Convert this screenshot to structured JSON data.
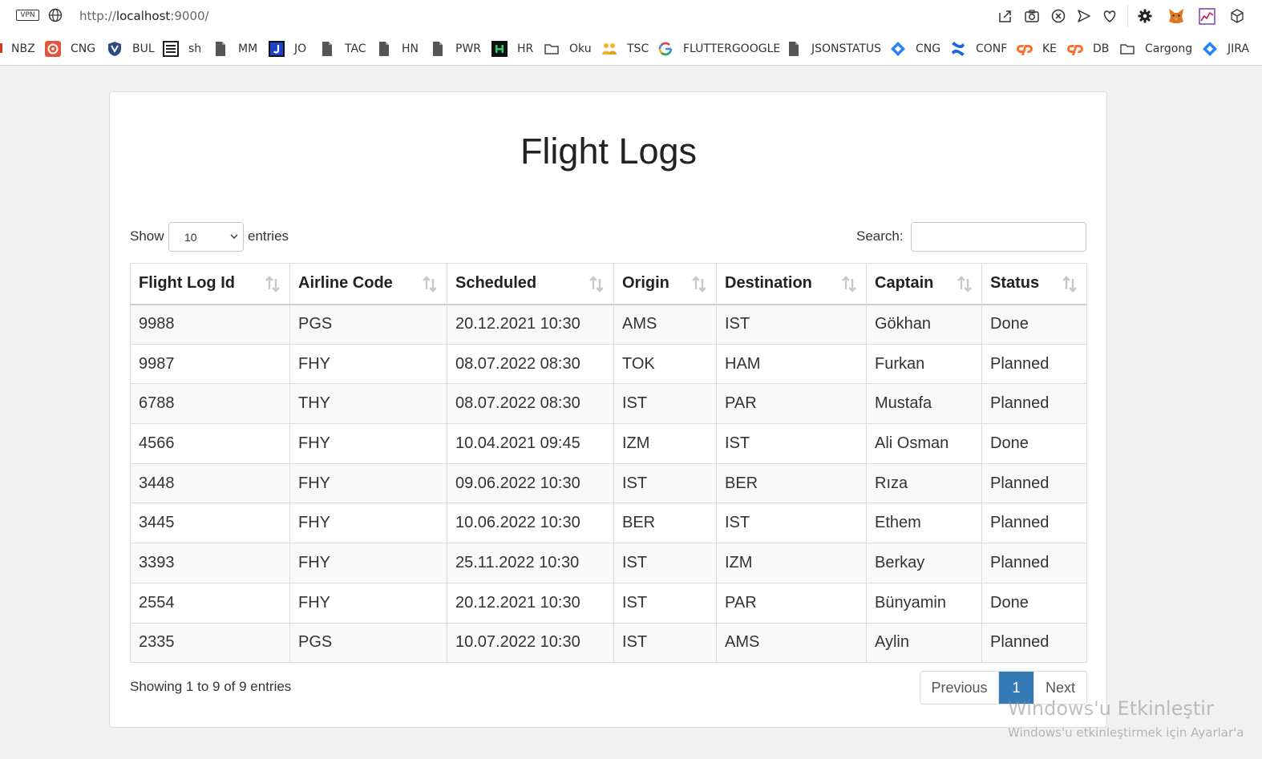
{
  "browser": {
    "vpn_label": "VPN",
    "url_scheme": "http://",
    "url_host": "localhost",
    "url_port": ":9000/",
    "toolbar_icons": [
      "share-icon",
      "camera-icon",
      "block-icon",
      "send-icon",
      "heart-icon",
      "settings-icon",
      "metamask-icon",
      "chart-icon",
      "cube-icon"
    ]
  },
  "bookmarks": [
    {
      "label": "NBZ",
      "icon": "none"
    },
    {
      "label": "CNG",
      "icon": "red-circle-icon",
      "color": "#e2543c"
    },
    {
      "label": "BUL",
      "icon": "shield-icon",
      "color": "#2b4c80"
    },
    {
      "label": "sh",
      "icon": "list-icon",
      "color": "#222222"
    },
    {
      "label": "MM",
      "icon": "page-icon"
    },
    {
      "label": "JO",
      "icon": "j-square-icon",
      "color": "#1a43c9"
    },
    {
      "label": "TAC",
      "icon": "page-icon"
    },
    {
      "label": "HN",
      "icon": "page-icon"
    },
    {
      "label": "PWR",
      "icon": "page-icon"
    },
    {
      "label": "HR",
      "icon": "hr-badge-icon",
      "color": "#111111"
    },
    {
      "label": "Oku",
      "icon": "folder-icon"
    },
    {
      "label": "TSC",
      "icon": "people-icon",
      "color": "#f2b531"
    },
    {
      "label": "FLUTTERGOOGLE",
      "icon": "google-icon"
    },
    {
      "label": "JSONSTATUS",
      "icon": "page-icon"
    },
    {
      "label": "CNG",
      "icon": "diamond-icon",
      "color": "#2684ff"
    },
    {
      "label": "CONF",
      "icon": "confluence-icon",
      "color": "#1868db"
    },
    {
      "label": "KE",
      "icon": "cpanel-icon",
      "color": "#ff6c2c"
    },
    {
      "label": "DB",
      "icon": "cpanel-icon",
      "color": "#ff6c2c"
    },
    {
      "label": "Cargong",
      "icon": "folder-icon"
    },
    {
      "label": "JIRA",
      "icon": "diamond-icon",
      "color": "#2684ff"
    }
  ],
  "page": {
    "title": "Flight Logs",
    "show_label": "Show",
    "entries_label": "entries",
    "page_length_value": "10",
    "search_label": "Search:",
    "search_value": ""
  },
  "table": {
    "columns": [
      "Flight Log Id",
      "Airline Code",
      "Scheduled",
      "Origin",
      "Destination",
      "Captain",
      "Status"
    ],
    "rows": [
      [
        "9988",
        "PGS",
        "20.12.2021 10:30",
        "AMS",
        "IST",
        "Gökhan",
        "Done"
      ],
      [
        "9987",
        "FHY",
        "08.07.2022 08:30",
        "TOK",
        "HAM",
        "Furkan",
        "Planned"
      ],
      [
        "6788",
        "THY",
        "08.07.2022 08:30",
        "IST",
        "PAR",
        "Mustafa",
        "Planned"
      ],
      [
        "4566",
        "FHY",
        "10.04.2021 09:45",
        "IZM",
        "IST",
        "Ali Osman",
        "Done"
      ],
      [
        "3448",
        "FHY",
        "09.06.2022 10:30",
        "IST",
        "BER",
        "Rıza",
        "Planned"
      ],
      [
        "3445",
        "FHY",
        "10.06.2022 10:30",
        "BER",
        "IST",
        "Ethem",
        "Planned"
      ],
      [
        "3393",
        "FHY",
        "25.11.2022 10:30",
        "IST",
        "IZM",
        "Berkay",
        "Planned"
      ],
      [
        "2554",
        "FHY",
        "20.12.2021 10:30",
        "IST",
        "PAR",
        "Bünyamin",
        "Done"
      ],
      [
        "2335",
        "PGS",
        "10.07.2022 10:30",
        "IST",
        "AMS",
        "Aylin",
        "Planned"
      ]
    ]
  },
  "footer": {
    "info": "Showing 1 to 9 of 9 entries",
    "previous_label": "Previous",
    "current_page": "1",
    "next_label": "Next",
    "accent_color": "#337ab7"
  },
  "watermark": {
    "line1": "Windows'u Etkinleştir",
    "line2": "Windows'u etkinleştirmek için Ayarlar'a"
  }
}
